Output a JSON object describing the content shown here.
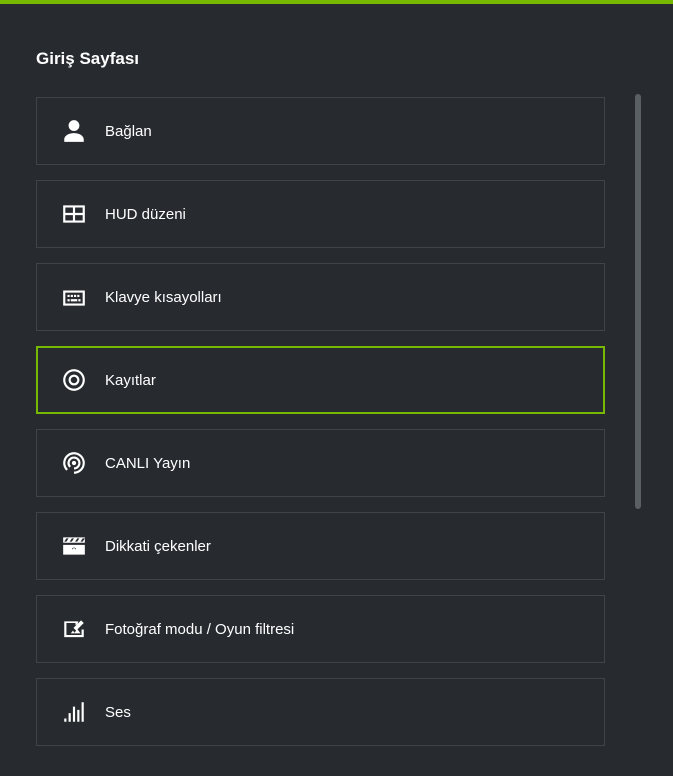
{
  "page": {
    "title": "Giriş Sayfası"
  },
  "menu": {
    "items": [
      {
        "id": "connect",
        "label": "Bağlan",
        "icon": "user-icon",
        "selected": false
      },
      {
        "id": "hud",
        "label": "HUD düzeni",
        "icon": "layout-icon",
        "selected": false
      },
      {
        "id": "keyboard",
        "label": "Klavye kısayolları",
        "icon": "keyboard-icon",
        "selected": false
      },
      {
        "id": "records",
        "label": "Kayıtlar",
        "icon": "record-icon",
        "selected": true
      },
      {
        "id": "broadcast",
        "label": "CANLI Yayın",
        "icon": "broadcast-icon",
        "selected": false
      },
      {
        "id": "highlights",
        "label": "Dikkati çekenler",
        "icon": "clapboard-icon",
        "selected": false
      },
      {
        "id": "photo",
        "label": "Fotoğraf modu / Oyun filtresi",
        "icon": "photo-edit-icon",
        "selected": false
      },
      {
        "id": "audio",
        "label": "Ses",
        "icon": "equalizer-icon",
        "selected": false
      }
    ]
  },
  "colors": {
    "accent": "#76b900",
    "background": "#272b30",
    "border": "#3e444a"
  }
}
